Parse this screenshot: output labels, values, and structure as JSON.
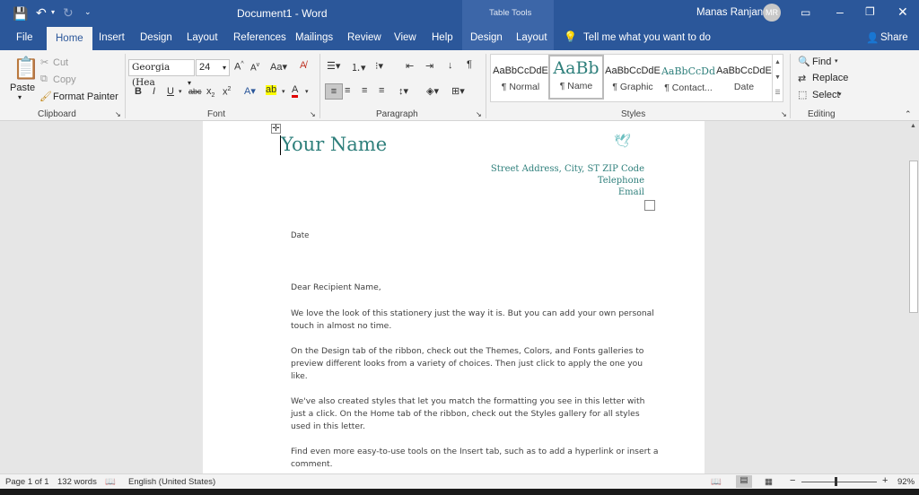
{
  "window": {
    "doc_title": "Document1",
    "separator": "-",
    "app_name": "Word",
    "context_tab_group": "Table Tools",
    "user_name": "Manas Ranjan",
    "user_initials": "MR"
  },
  "tabs": [
    "File",
    "Home",
    "Insert",
    "Design",
    "Layout",
    "References",
    "Mailings",
    "Review",
    "View",
    "Help",
    "Design",
    "Layout"
  ],
  "tell_me": "Tell me what you want to do",
  "share": "Share",
  "clipboard": {
    "paste": "Paste",
    "cut": "Cut",
    "copy": "Copy",
    "format_painter": "Format Painter",
    "label": "Clipboard"
  },
  "font": {
    "name": "Georgia (Hea",
    "size": "24",
    "label": "Font"
  },
  "paragraph": {
    "label": "Paragraph"
  },
  "styles": {
    "label": "Styles",
    "items": [
      {
        "preview": "AaBbCcDdE",
        "name": "¶ Normal"
      },
      {
        "preview": "AaBb",
        "name": "¶ Name"
      },
      {
        "preview": "AaBbCcDdE",
        "name": "¶ Graphic"
      },
      {
        "preview": "AaBbCcDd",
        "name": "¶ Contact..."
      },
      {
        "preview": "AaBbCcDdE",
        "name": "Date"
      }
    ]
  },
  "editing": {
    "find": "Find",
    "replace": "Replace",
    "select": "Select",
    "label": "Editing"
  },
  "document": {
    "name": "Your Name",
    "address": "Street Address, City, ST ZIP Code",
    "telephone": "Telephone",
    "email": "Email",
    "date": "Date",
    "salutation": "Dear Recipient Name,",
    "p1_l1": "We love the look of this stationery just the way it is. But you can add your own personal",
    "p1_l2": "touch in almost no time.",
    "p2_l1": "On the Design tab of the ribbon, check out the Themes, Colors, and Fonts galleries to",
    "p2_l2": "preview different looks from a variety of choices. Then just click to apply the one you",
    "p2_l3": "like.",
    "p3_l1": "We've also created styles that let you match the formatting you see in this letter with",
    "p3_l2": "just a click. On the Home tab of the ribbon, check out the Styles gallery for all styles",
    "p3_l3": "used in this letter.",
    "p4_l1": "Find even more easy-to-use tools on the Insert tab, such as to add a hyperlink or insert a",
    "p4_l2": "comment."
  },
  "status": {
    "page": "Page 1 of 1",
    "words": "132 words",
    "language": "English (United States)",
    "zoom": "92%"
  },
  "colors": {
    "word_blue": "#2b579a",
    "accent_teal": "#2e7f7b"
  }
}
